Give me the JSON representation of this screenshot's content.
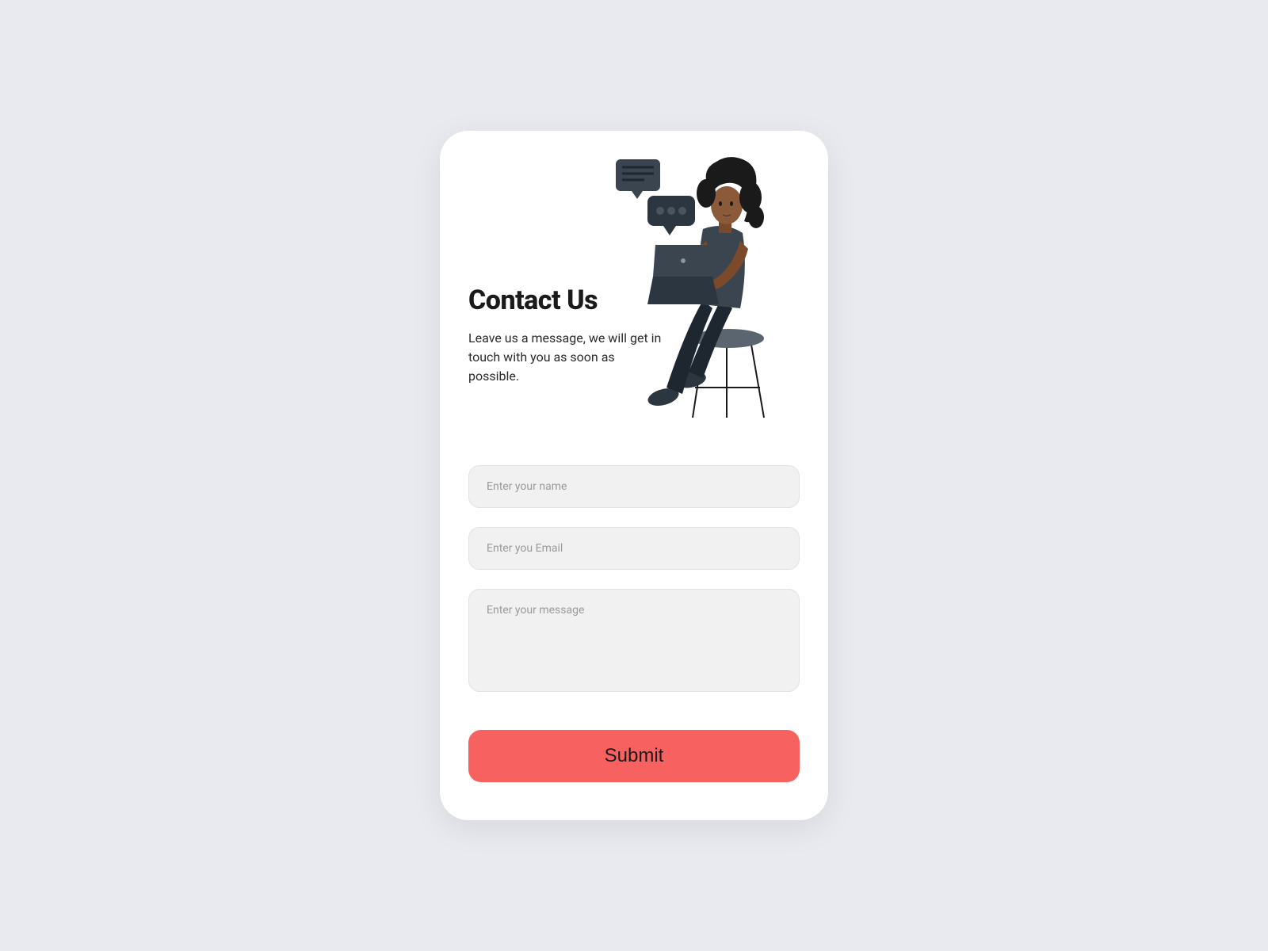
{
  "header": {
    "title": "Contact Us",
    "subtitle": "Leave us a message, we will get in touch with you as soon as possible."
  },
  "form": {
    "name_placeholder": "Enter your name",
    "email_placeholder": "Enter you Email",
    "message_placeholder": "Enter your message",
    "submit_label": "Submit"
  },
  "illustration": {
    "name": "person-with-laptop-icon"
  },
  "colors": {
    "accent": "#f76160",
    "background": "#e8eaf0",
    "card": "#ffffff",
    "input_bg": "#f1f1f1"
  }
}
